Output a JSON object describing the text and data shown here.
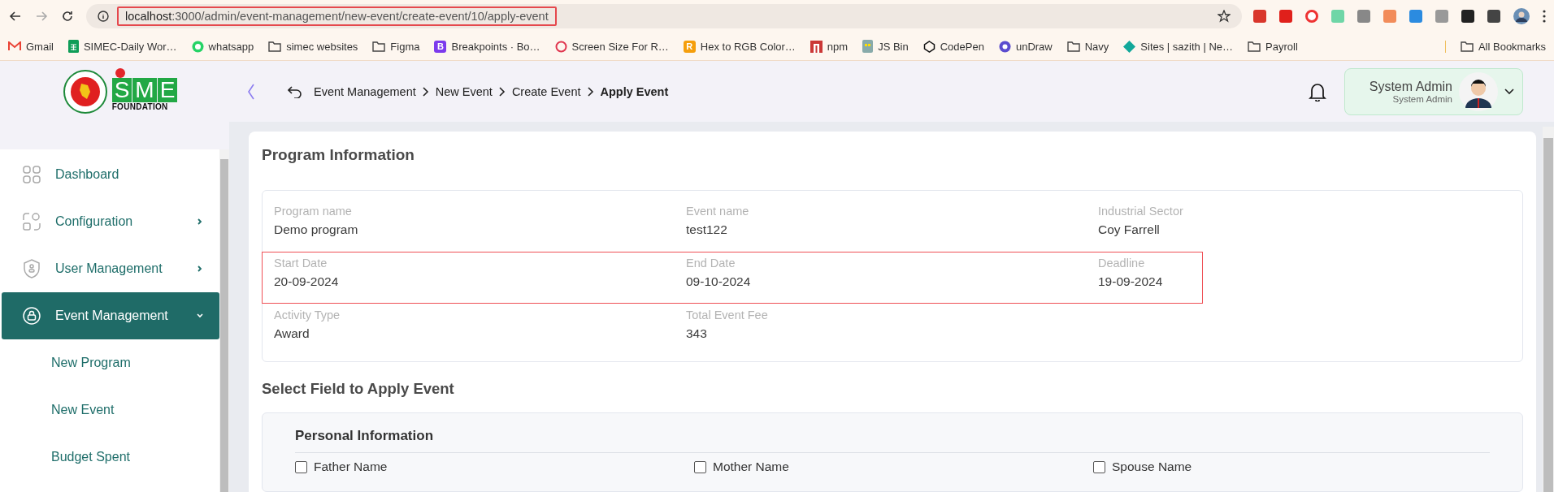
{
  "browser": {
    "url_host": "localhost",
    "url_path": ":3000/admin/event-management/new-event/create-event/10/apply-event",
    "url_highlighted": true,
    "bookmarks": [
      {
        "kind": "gmail",
        "label": "Gmail"
      },
      {
        "kind": "sheet",
        "label": "SIMEC-Daily Wor…"
      },
      {
        "kind": "chat",
        "label": "whatsapp"
      },
      {
        "kind": "folder",
        "label": "simec websites"
      },
      {
        "kind": "folder",
        "label": "Figma"
      },
      {
        "kind": "letter",
        "label": "Breakpoints · Bo…",
        "glyph": "B",
        "color": "#7c3aed"
      },
      {
        "kind": "ring",
        "label": "Screen Size For R…"
      },
      {
        "kind": "letter",
        "label": "Hex to RGB Color…",
        "glyph": "R",
        "color": "#f59e0b"
      },
      {
        "kind": "npm",
        "label": "npm"
      },
      {
        "kind": "bin",
        "label": "JS Bin"
      },
      {
        "kind": "cube",
        "label": "CodePen"
      },
      {
        "kind": "circle",
        "label": "unDraw"
      },
      {
        "kind": "folder",
        "label": "Navy"
      },
      {
        "kind": "diamond",
        "label": "Sites | sazith | Ne…"
      },
      {
        "kind": "folder",
        "label": "Payroll"
      }
    ],
    "all_bookmarks": "All Bookmarks"
  },
  "header": {
    "logo_letters": "SME",
    "logo_caption": "FOUNDATION",
    "breadcrumbs": [
      {
        "label": "Event Management",
        "current": false
      },
      {
        "label": "New Event",
        "current": false
      },
      {
        "label": "Create Event",
        "current": false
      },
      {
        "label": "Apply Event",
        "current": true
      }
    ],
    "user": {
      "name": "System Admin",
      "role": "System Admin"
    }
  },
  "sidebar": {
    "items": [
      {
        "label": "Dashboard",
        "selected": false
      },
      {
        "label": "Configuration",
        "selected": false,
        "expanded": false
      },
      {
        "label": "User Management",
        "selected": false,
        "expanded": false
      },
      {
        "label": "Event Management",
        "selected": true,
        "expanded": true,
        "children": [
          {
            "label": "New Program"
          },
          {
            "label": "New Event"
          },
          {
            "label": "Budget Spent"
          }
        ]
      }
    ]
  },
  "program_information": {
    "title": "Program Information",
    "rows": [
      {
        "highlighted": false,
        "fields": [
          {
            "label": "Program name",
            "value": "Demo program"
          },
          {
            "label": "Event name",
            "value": "test122"
          },
          {
            "label": "Industrial Sector",
            "value": "Coy Farrell"
          }
        ]
      },
      {
        "highlighted": true,
        "fields": [
          {
            "label": "Start Date",
            "value": "20-09-2024"
          },
          {
            "label": "End Date",
            "value": "09-10-2024"
          },
          {
            "label": "Deadline",
            "value": "19-09-2024"
          }
        ]
      },
      {
        "highlighted": false,
        "fields": [
          {
            "label": "Activity Type",
            "value": "Award"
          },
          {
            "label": "Total Event Fee",
            "value": "343"
          }
        ]
      }
    ]
  },
  "apply_fields": {
    "title": "Select Field to Apply Event",
    "sections": [
      {
        "title": "Personal Information",
        "options": [
          {
            "label": "Father Name",
            "checked": false
          },
          {
            "label": "Mother Name",
            "checked": false
          },
          {
            "label": "Spouse Name",
            "checked": false
          }
        ]
      }
    ]
  }
}
